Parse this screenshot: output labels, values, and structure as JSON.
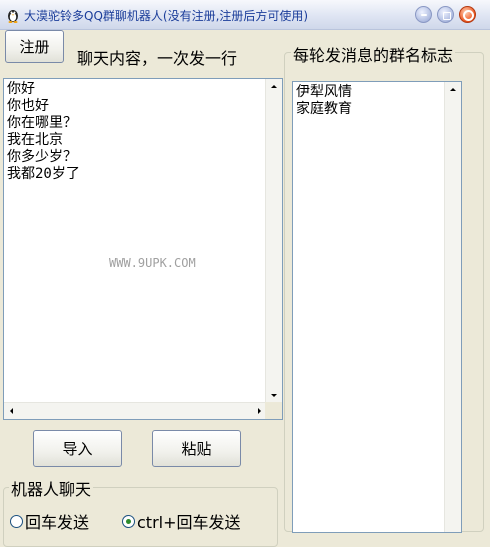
{
  "window": {
    "title": "大漠驼铃多QQ群聊机器人(没有注册,注册后方可使用)",
    "icon": "penguin-icon"
  },
  "toolbar": {
    "register_label": "注册",
    "chat_content_label": "聊天内容，一次发一行"
  },
  "chat": {
    "lines": [
      "你好",
      "你也好",
      "你在哪里？",
      "我在北京",
      "你多少岁？",
      "我都20岁了"
    ],
    "watermark": "WWW.9UPK.COM"
  },
  "actions": {
    "import_label": "导入",
    "paste_label": "粘贴"
  },
  "groups": {
    "legend": "每轮发消息的群名标志",
    "lines": [
      "伊犁风情",
      "家庭教育"
    ]
  },
  "robot": {
    "legend": "机器人聊天",
    "options": [
      {
        "label": "回车发送",
        "selected": false
      },
      {
        "label": "ctrl+回车发送",
        "selected": true
      }
    ]
  },
  "colors": {
    "title_text": "#1b3d9a",
    "box_border": "#7f9db9",
    "window_bg": "#ece9d8",
    "close_button": "#ee5a24"
  }
}
